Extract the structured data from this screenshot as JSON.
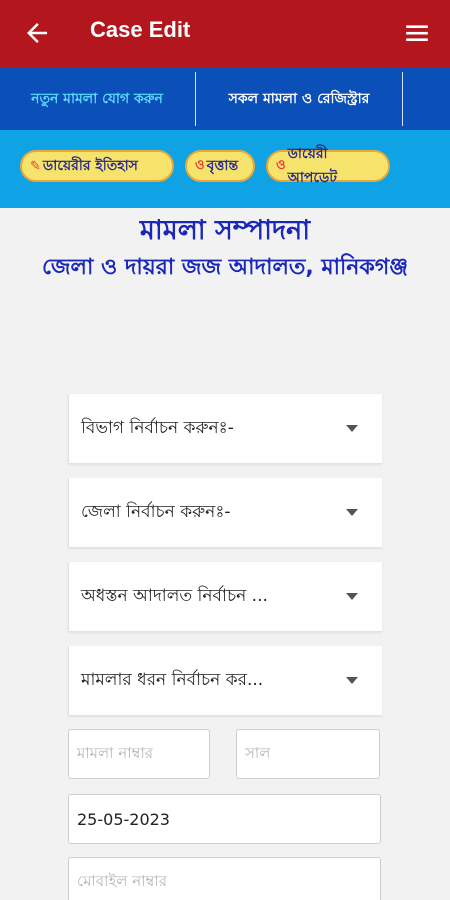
{
  "appbar": {
    "title": "Case Edit",
    "back_icon": "arrow-left-icon",
    "menu_icon": "hamburger-menu-icon"
  },
  "tabs": [
    {
      "label": "নতুন মামলা যোগ করুন"
    },
    {
      "label": "সকল মামলা ও রেজিস্ট্রার"
    }
  ],
  "chips": [
    {
      "icon": "✎",
      "label": "ডায়েরীর ইতিহাস"
    },
    {
      "icon": "ও",
      "label": "বৃত্তান্ত"
    },
    {
      "icon": "ও",
      "label": "ডায়েরী আপডেট"
    }
  ],
  "page": {
    "heading": "মামলা সম্পাদনা",
    "subheading": "জেলা ও দায়রা জজ আদালত, মানিকগঞ্জ"
  },
  "form": {
    "division_select": "বিভাগ নির্বাচন করুনঃ-",
    "district_select": "জেলা নির্বাচন করুনঃ-",
    "court_select": "অধস্তন আদালত নির্বাচন ...",
    "case_type_select": "মামলার ধরন নির্বাচন কর...",
    "case_number_placeholder": "মামলা নাম্বার",
    "year_placeholder": "সাল",
    "date_value": "25-05-2023",
    "mobile_placeholder": "মোবাইল নাম্বার"
  },
  "colors": {
    "appbar": "#b3171d",
    "tabs": "#0b4fb8",
    "chipbar": "#0fa3e6",
    "heading": "#1a27b8"
  }
}
